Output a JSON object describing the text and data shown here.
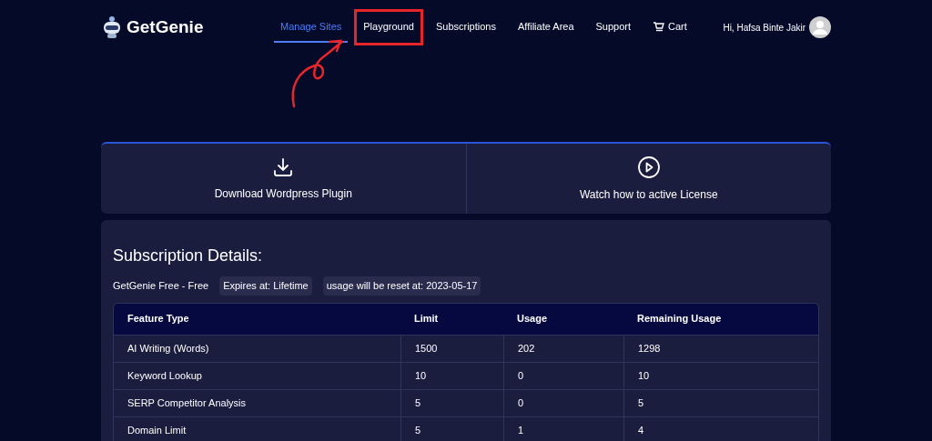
{
  "brand": {
    "name": "GetGenie"
  },
  "nav": [
    {
      "label": "Manage Sites",
      "selected": true,
      "annotated": false,
      "kind": "link"
    },
    {
      "label": "Playground",
      "selected": false,
      "annotated": true,
      "kind": "link"
    },
    {
      "label": "Subscriptions",
      "selected": false,
      "annotated": false,
      "kind": "link"
    },
    {
      "label": "Affiliate Area",
      "selected": false,
      "annotated": false,
      "kind": "link"
    },
    {
      "label": "Support",
      "selected": false,
      "annotated": false,
      "kind": "link"
    },
    {
      "label": "Cart",
      "selected": false,
      "annotated": false,
      "kind": "cart"
    }
  ],
  "user": {
    "greeting": "Hi, Hafsa Binte Jakir"
  },
  "actions": [
    {
      "label": "Download Wordpress Plugin",
      "kind": "download"
    },
    {
      "label": "Watch how to active License",
      "kind": "play"
    }
  ],
  "subscription": {
    "title": "Subscription Details:",
    "plan": "GetGenie Free - Free",
    "badges": [
      "Expires at: Lifetime",
      "usage will be reset at: 2023-05-17"
    ],
    "table": {
      "columns": [
        "Feature Type",
        "Limit",
        "Usage",
        "Remaining Usage"
      ],
      "rows": [
        [
          "AI Writing (Words)",
          "1500",
          "202",
          "1298"
        ],
        [
          "Keyword Lookup",
          "10",
          "0",
          "10"
        ],
        [
          "SERP Competitor Analysis",
          "5",
          "0",
          "5"
        ],
        [
          "Domain Limit",
          "5",
          "1",
          "4"
        ]
      ]
    }
  }
}
